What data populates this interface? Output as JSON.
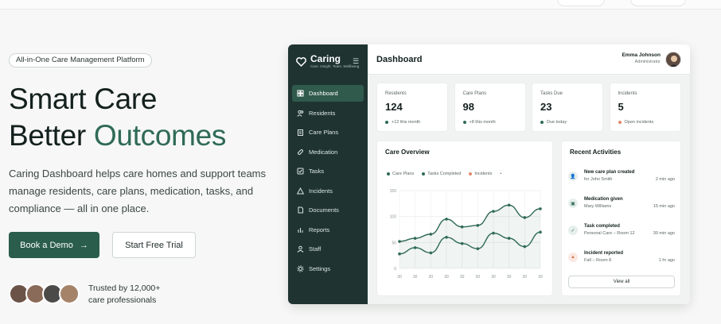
{
  "hero": {
    "badge": "All-in-One Care Management Platform",
    "headline_line1": "Smart Care",
    "headline_line2_plain": "Better ",
    "headline_line2_accent": "Outcomes",
    "lede": "Caring Dashboard helps care homes and support teams manage residents, care plans, medication, tasks, and compliance — all in one place.",
    "primary_cta": "Book a Demo",
    "primary_cta_arrow": "→",
    "secondary_cta": "Start Free Trial",
    "trusted_line1": "Trusted by 12,000+",
    "trusted_line2": "care professionals"
  },
  "colors": {
    "brand": "#2a5d4c",
    "accent_text": "#2f6a56",
    "sidebar_bg": "#1f3431",
    "sidebar_active": "#2f5a4c",
    "series_care_plans": "#2f6a56",
    "series_tasks": "#2f6a56",
    "series_incidents": "#e08a6d"
  },
  "dashboard": {
    "brand_name": "Caring",
    "brand_tagline": "Care. Insight. Team. Wellbeing.",
    "nav": [
      {
        "label": "Dashboard",
        "icon": "grid-icon",
        "active": true
      },
      {
        "label": "Residents",
        "icon": "users-icon",
        "active": false
      },
      {
        "label": "Care Plans",
        "icon": "clipboard-icon",
        "active": false
      },
      {
        "label": "Medication",
        "icon": "pill-icon",
        "active": false
      },
      {
        "label": "Tasks",
        "icon": "checkbox-icon",
        "active": false
      },
      {
        "label": "Incidents",
        "icon": "warning-icon",
        "active": false
      },
      {
        "label": "Documents",
        "icon": "document-icon",
        "active": false
      },
      {
        "label": "Reports",
        "icon": "chart-icon",
        "active": false
      },
      {
        "label": "Staff",
        "icon": "staff-icon",
        "active": false
      },
      {
        "label": "Settings",
        "icon": "gear-icon",
        "active": false
      }
    ],
    "page_title": "Dashboard",
    "user": {
      "name": "Emma Johnson",
      "role": "Administrator"
    },
    "stats": [
      {
        "label": "Residents",
        "value": "124",
        "sub": "+12 this month",
        "dot": "#2f6a56"
      },
      {
        "label": "Care Plans",
        "value": "98",
        "sub": "+8 this month",
        "dot": "#2f6a56"
      },
      {
        "label": "Tasks Due",
        "value": "23",
        "sub": "Due today",
        "dot": "#2f6a56"
      },
      {
        "label": "Incidents",
        "value": "5",
        "sub": "Open incidents",
        "dot": "#e08a6d"
      }
    ],
    "overview_title": "Care Overview",
    "activities_title": "Recent Activities",
    "activities": [
      {
        "title": "New care plan created",
        "sub": "for John Smith",
        "time": "2 min ago",
        "icon": "person-icon",
        "bg": "#e6efec",
        "fg": "#2f6a56",
        "glyph": "👤"
      },
      {
        "title": "Medication given",
        "sub": "Mary Williams",
        "time": "15 min ago",
        "icon": "pill-icon",
        "bg": "#e6efec",
        "fg": "#2f6a56",
        "glyph": "▣"
      },
      {
        "title": "Task completed",
        "sub": "Personal Care – Room 12",
        "time": "30 min ago",
        "icon": "check-icon",
        "bg": "#e6efec",
        "fg": "#2f6a56",
        "glyph": "✓"
      },
      {
        "title": "Incident reported",
        "sub": "Fall – Room 8",
        "time": "1 hr ago",
        "icon": "warning-icon",
        "bg": "#fbe9e3",
        "fg": "#d8704e",
        "glyph": "▲"
      }
    ],
    "view_all": "View all"
  },
  "chart_data": {
    "type": "line",
    "title": "Care Overview",
    "xlabel": "",
    "ylabel": "",
    "x": [
      "30",
      "30",
      "30",
      "30",
      "30",
      "30",
      "30",
      "30",
      "30",
      "30"
    ],
    "ylim": [
      0,
      150
    ],
    "yticks": [
      "150",
      "100",
      "50",
      "0"
    ],
    "grid": true,
    "legend_position": "top",
    "series": [
      {
        "name": "Care Plans",
        "color": "#2f6a56",
        "values": [
          52,
          58,
          66,
          95,
          80,
          83,
          110,
          122,
          98,
          115
        ]
      },
      {
        "name": "Tasks Completed",
        "color": "#2f6a56",
        "values": [
          28,
          40,
          30,
          60,
          48,
          38,
          68,
          58,
          42,
          70
        ]
      },
      {
        "name": "Incidents",
        "color": "#e08a6d",
        "values": []
      }
    ]
  }
}
